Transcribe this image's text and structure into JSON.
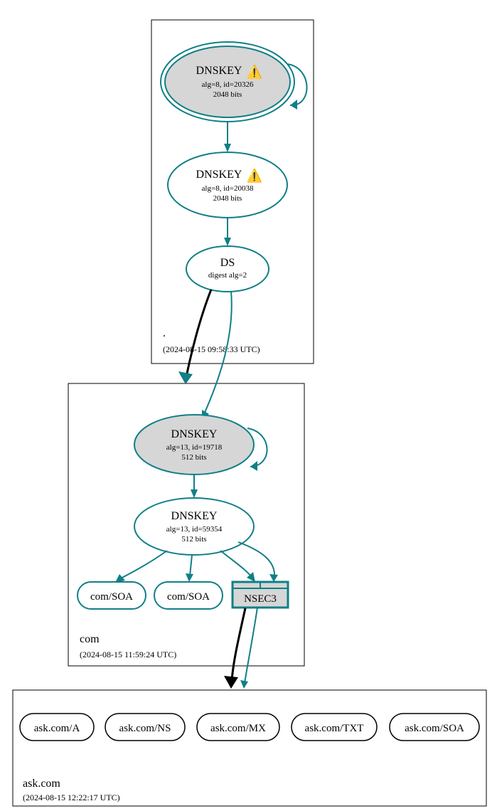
{
  "zones": {
    "root": {
      "title": ".",
      "timestamp": "(2024-08-15 09:58:33 UTC)"
    },
    "com": {
      "title": "com",
      "timestamp": "(2024-08-15 11:59:24 UTC)"
    },
    "ask": {
      "title": "ask.com",
      "timestamp": "(2024-08-15 12:22:17 UTC)"
    }
  },
  "nodes": {
    "root_ksk": {
      "title": "DNSKEY",
      "warn": "⚠️",
      "line1": "alg=8, id=20326",
      "line2": "2048 bits"
    },
    "root_zsk": {
      "title": "DNSKEY",
      "warn": "⚠️",
      "line1": "alg=8, id=20038",
      "line2": "2048 bits"
    },
    "root_ds": {
      "title": "DS",
      "line1": "digest alg=2"
    },
    "com_ksk": {
      "title": "DNSKEY",
      "line1": "alg=13, id=19718",
      "line2": "512 bits"
    },
    "com_zsk": {
      "title": "DNSKEY",
      "line1": "alg=13, id=59354",
      "line2": "512 bits"
    },
    "com_soa1": {
      "title": "com/SOA"
    },
    "com_soa2": {
      "title": "com/SOA"
    },
    "com_nsec3": {
      "title": "NSEC3"
    },
    "ask_a": {
      "title": "ask.com/A"
    },
    "ask_ns": {
      "title": "ask.com/NS"
    },
    "ask_mx": {
      "title": "ask.com/MX"
    },
    "ask_txt": {
      "title": "ask.com/TXT"
    },
    "ask_soa": {
      "title": "ask.com/SOA"
    }
  }
}
